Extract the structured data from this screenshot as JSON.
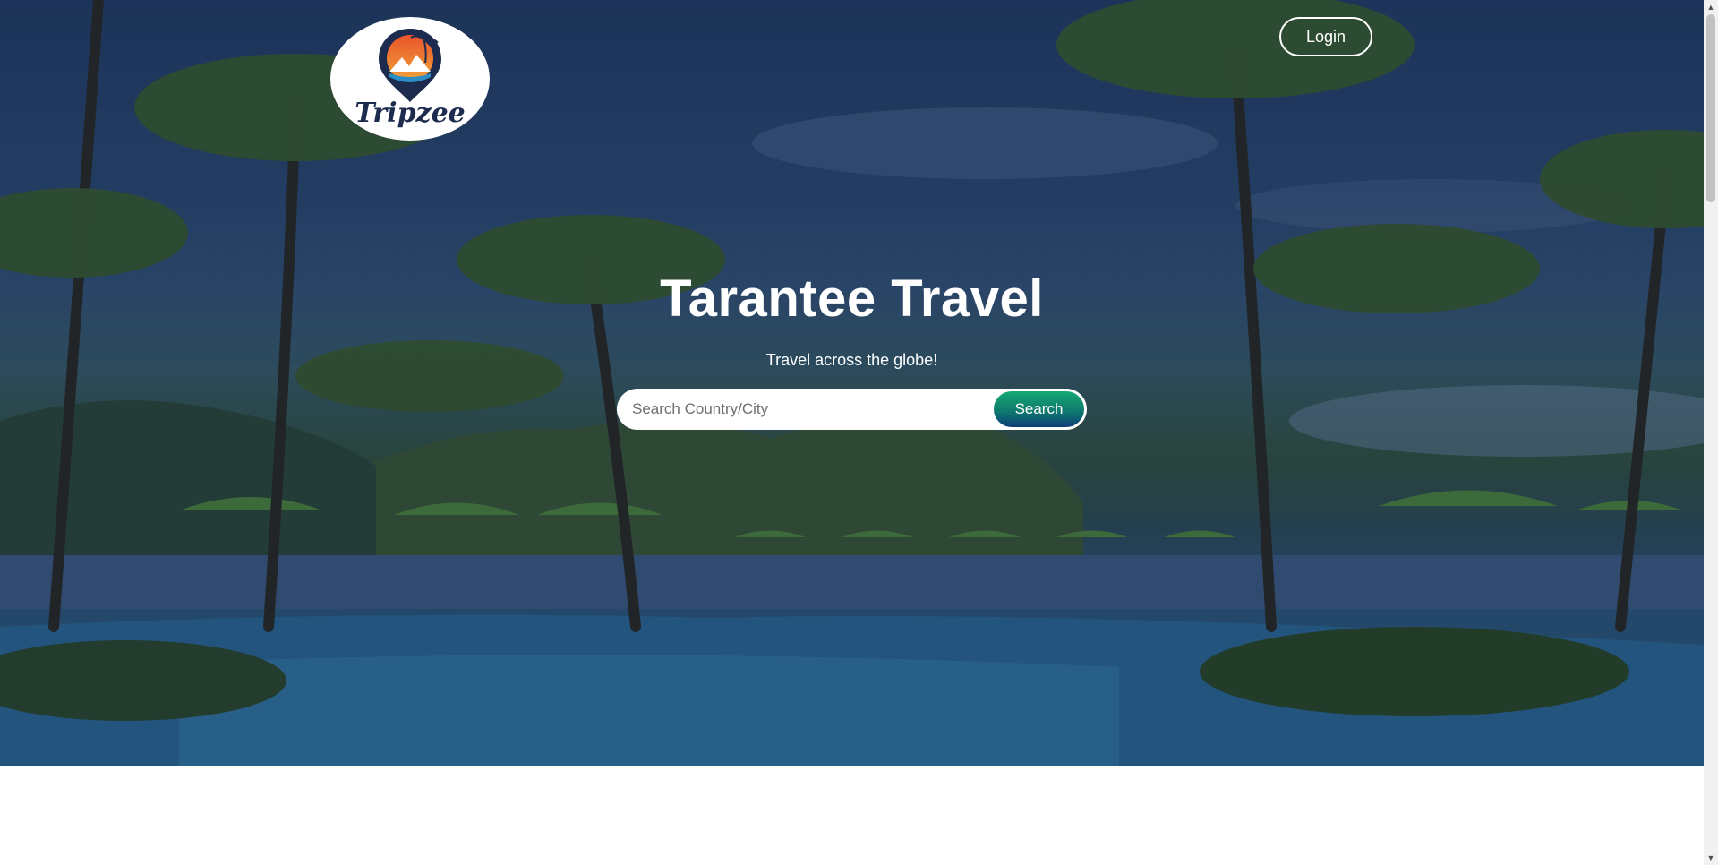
{
  "logo": {
    "text": "Tripzee"
  },
  "header": {
    "login_label": "Login"
  },
  "hero": {
    "title": "Tarantee Travel",
    "subtitle": "Travel across the globe!"
  },
  "search": {
    "placeholder": "Search Country/City",
    "value": "",
    "button_label": "Search"
  },
  "scrollbar": {
    "up_icon": "▲",
    "down_icon": "▼"
  },
  "colors": {
    "search_button_top": "#14a872",
    "search_button_bottom": "#0d3d78",
    "logo_text": "#1d2b4f"
  }
}
